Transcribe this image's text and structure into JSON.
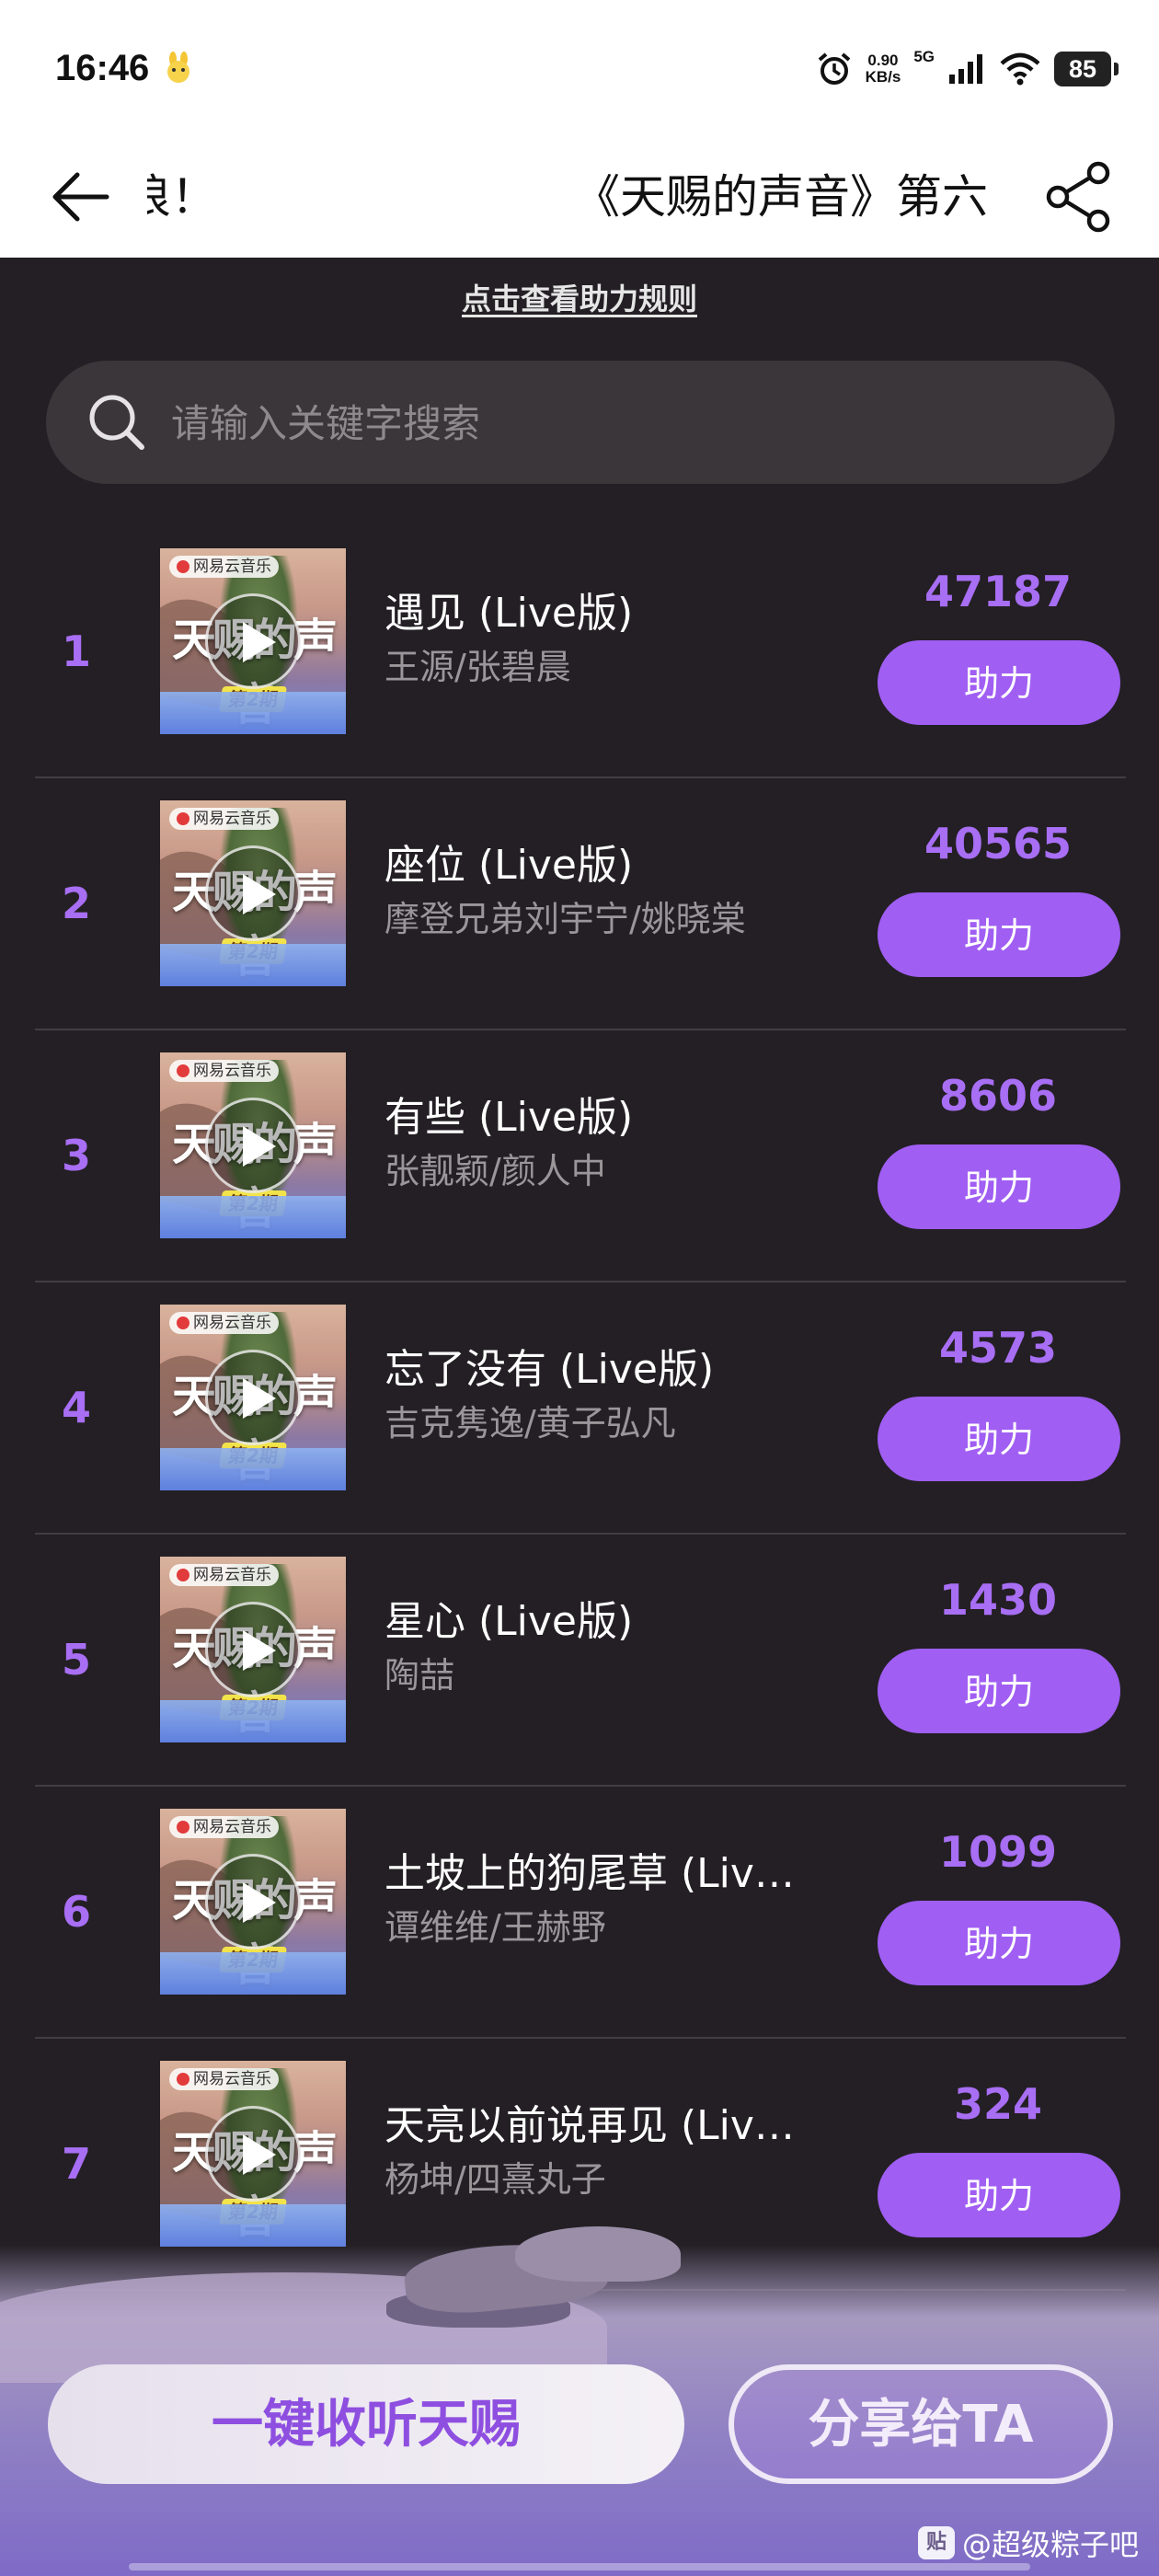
{
  "status_bar": {
    "time": "16:46",
    "net_speed_value": "0.90",
    "net_speed_unit": "KB/s",
    "network_type": "5G",
    "battery": "85"
  },
  "header": {
    "title_left": "浪！",
    "title_main": "《天赐的声音》第六"
  },
  "rules_link": "点击查看助力规则",
  "search": {
    "placeholder": "请输入关键字搜索"
  },
  "cover": {
    "badge": "网易云音乐",
    "show_title": "天赐的声音",
    "episode": "第2期"
  },
  "boost_label": "助力",
  "songs": [
    {
      "rank": "1",
      "title": "遇见 (Live版)",
      "artist": "王源/张碧晨",
      "votes": "47187"
    },
    {
      "rank": "2",
      "title": "座位 (Live版)",
      "artist": "摩登兄弟刘宇宁/姚晓棠",
      "votes": "40565"
    },
    {
      "rank": "3",
      "title": "有些 (Live版)",
      "artist": "张靓颖/颜人中",
      "votes": "8606"
    },
    {
      "rank": "4",
      "title": "忘了没有 (Live版)",
      "artist": "吉克隽逸/黄子弘凡",
      "votes": "4573"
    },
    {
      "rank": "5",
      "title": "星心 (Live版)",
      "artist": "陶喆",
      "votes": "1430"
    },
    {
      "rank": "6",
      "title": "土坡上的狗尾草 (Liv…",
      "artist": "谭维维/王赫野",
      "votes": "1099"
    },
    {
      "rank": "7",
      "title": "天亮以前说再见 (Liv…",
      "artist": "杨坤/四熹丸子",
      "votes": "324"
    }
  ],
  "bottom": {
    "listen_all": "一键收听天赐",
    "share_ta": "分享给TA"
  },
  "watermark": {
    "logo": "贴",
    "text": "@超级粽子吧"
  },
  "colors": {
    "accent": "#a05ef3",
    "rank": "#a86ef4",
    "background": "#231f24"
  }
}
